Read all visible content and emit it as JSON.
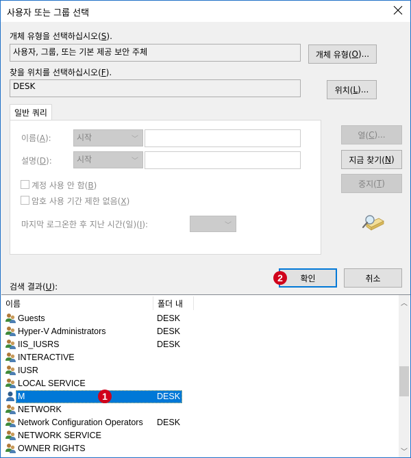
{
  "window": {
    "title": "사용자 또는 그룹 선택",
    "close_label": "✕"
  },
  "object_type": {
    "label_text": "개체 유형을 선택하십시오(",
    "label_key": "S",
    "label_suffix": ").",
    "value": "사용자, 그룹, 또는 기본 제공 보안 주체",
    "button_text": "개체 유형(",
    "button_key": "O",
    "button_suffix": ")..."
  },
  "location": {
    "label_text": "찾을 위치를 선택하십시오(",
    "label_key": "F",
    "label_suffix": ").",
    "value": "DESK",
    "button_text": "위치(",
    "button_key": "L",
    "button_suffix": ")..."
  },
  "query": {
    "tab_label": "일반 쿼리",
    "name_label_text": "이름(",
    "name_label_key": "A",
    "name_label_suffix": "):",
    "name_mode": "시작",
    "name_value": "",
    "desc_label_text": "설명(",
    "desc_label_key": "D",
    "desc_label_suffix": "):",
    "desc_mode": "시작",
    "desc_value": "",
    "disabled_accounts_text": "계정 사용 안 함(",
    "disabled_accounts_key": "B",
    "disabled_accounts_suffix": ")",
    "disabled_accounts_checked": false,
    "non_expiring_text": "암호 사용 기간 제한 없음(",
    "non_expiring_key": "X",
    "non_expiring_suffix": ")",
    "non_expiring_checked": false,
    "last_logon_text": "마지막 로그온한 후 지난 시간(일)(",
    "last_logon_key": "I",
    "last_logon_suffix": "):",
    "last_logon_value": ""
  },
  "side_buttons": {
    "columns_text": "열(",
    "columns_key": "C",
    "columns_suffix": ")...",
    "find_now_text": "지금 찾기(",
    "find_now_key": "N",
    "find_now_suffix": ")",
    "stop_text": "중지(",
    "stop_key": "T",
    "stop_suffix": ")"
  },
  "footer": {
    "results_label_text": "검색 결과(",
    "results_label_key": "U",
    "results_label_suffix": "):",
    "ok_label": "확인",
    "cancel_label": "취소"
  },
  "annotations": {
    "badge_1": "1",
    "badge_2": "2"
  },
  "results": {
    "columns": [
      "이름",
      "폴더 내"
    ],
    "rows": [
      {
        "name": "Guests",
        "folder": "DESK",
        "type": "group",
        "selected": false
      },
      {
        "name": "Hyper-V Administrators",
        "folder": "DESK",
        "type": "group",
        "selected": false
      },
      {
        "name": "IIS_IUSRS",
        "folder": "DESK",
        "type": "group",
        "selected": false
      },
      {
        "name": "INTERACTIVE",
        "folder": "",
        "type": "group",
        "selected": false
      },
      {
        "name": "IUSR",
        "folder": "",
        "type": "group",
        "selected": false
      },
      {
        "name": "LOCAL SERVICE",
        "folder": "",
        "type": "group",
        "selected": false
      },
      {
        "name": "M",
        "folder": "DESK",
        "type": "user",
        "selected": true
      },
      {
        "name": "NETWORK",
        "folder": "",
        "type": "group",
        "selected": false
      },
      {
        "name": "Network Configuration Operators",
        "folder": "DESK",
        "type": "group",
        "selected": false
      },
      {
        "name": "NETWORK SERVICE",
        "folder": "",
        "type": "group",
        "selected": false
      },
      {
        "name": "OWNER RIGHTS",
        "folder": "",
        "type": "group",
        "selected": false
      }
    ]
  }
}
